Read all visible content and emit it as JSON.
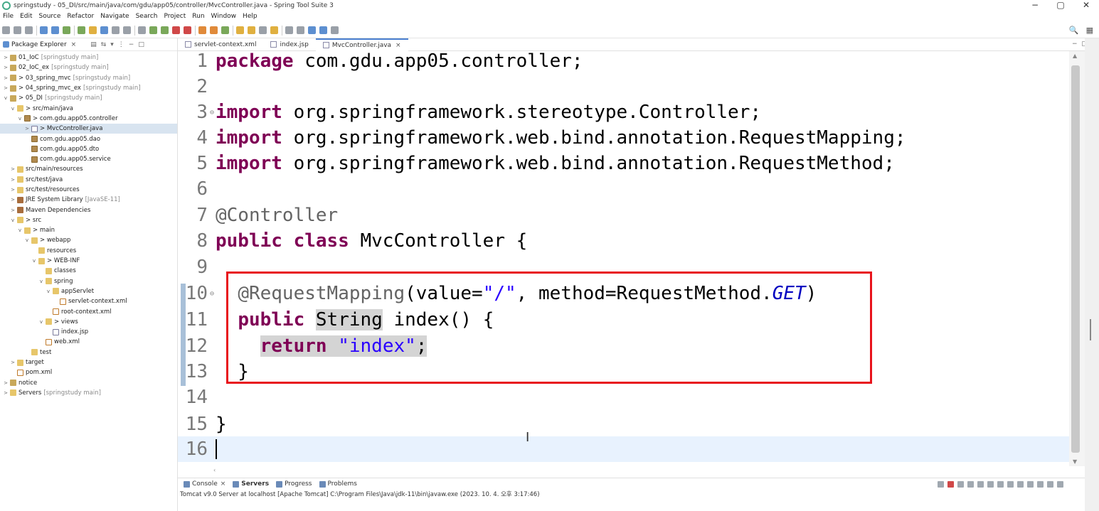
{
  "window": {
    "title": "springstudy - 05_DI/src/main/java/com/gdu/app05/controller/MvcController.java - Spring Tool Suite 3",
    "minimize": "−",
    "maximize": "▢",
    "close": "✕"
  },
  "menu": [
    "File",
    "Edit",
    "Source",
    "Refactor",
    "Navigate",
    "Search",
    "Project",
    "Run",
    "Window",
    "Help"
  ],
  "toolbar_right": {
    "search": "🔍",
    "perspective": "▦"
  },
  "package_explorer": {
    "title": "Package Explorer",
    "close": "×",
    "tree": [
      {
        "arrow": ">",
        "icon": "proj",
        "label": "01_IoC",
        "dec": "[springstudy main]"
      },
      {
        "arrow": ">",
        "icon": "proj",
        "label": "02_IoC_ex",
        "dec": "[springstudy main]"
      },
      {
        "arrow": ">",
        "icon": "proj",
        "label": "> 03_spring_mvc",
        "dec": "[springstudy main]"
      },
      {
        "arrow": ">",
        "icon": "proj",
        "label": "> 04_spring_mvc_ex",
        "dec": "[springstudy main]"
      },
      {
        "arrow": "v",
        "icon": "proj",
        "label": "> 05_DI",
        "dec": "[springstudy main]"
      },
      {
        "arrow": "v",
        "icon": "folder",
        "label": "> src/main/java",
        "dec": ""
      },
      {
        "arrow": "v",
        "icon": "pkg",
        "label": "> com.gdu.app05.controller",
        "dec": ""
      },
      {
        "arrow": ">",
        "icon": "file",
        "label": "> MvcController.java",
        "dec": ""
      },
      {
        "arrow": "",
        "icon": "pkg",
        "label": "com.gdu.app05.dao",
        "dec": ""
      },
      {
        "arrow": "",
        "icon": "pkg",
        "label": "com.gdu.app05.dto",
        "dec": ""
      },
      {
        "arrow": "",
        "icon": "pkg",
        "label": "com.gdu.app05.service",
        "dec": ""
      },
      {
        "arrow": ">",
        "icon": "folder",
        "label": "src/main/resources",
        "dec": ""
      },
      {
        "arrow": ">",
        "icon": "folder",
        "label": "src/test/java",
        "dec": ""
      },
      {
        "arrow": ">",
        "icon": "folder",
        "label": "src/test/resources",
        "dec": ""
      },
      {
        "arrow": ">",
        "icon": "lib",
        "label": "JRE System Library",
        "dec": "[JavaSE-11]"
      },
      {
        "arrow": ">",
        "icon": "lib",
        "label": "Maven Dependencies",
        "dec": ""
      },
      {
        "arrow": "v",
        "icon": "folder",
        "label": "> src",
        "dec": ""
      },
      {
        "arrow": "v",
        "icon": "folder",
        "label": "> main",
        "dec": ""
      },
      {
        "arrow": "v",
        "icon": "folder",
        "label": "> webapp",
        "dec": ""
      },
      {
        "arrow": "",
        "icon": "folder",
        "label": "resources",
        "dec": ""
      },
      {
        "arrow": "v",
        "icon": "folder",
        "label": "> WEB-INF",
        "dec": ""
      },
      {
        "arrow": "",
        "icon": "folder",
        "label": "classes",
        "dec": ""
      },
      {
        "arrow": "v",
        "icon": "folder",
        "label": "spring",
        "dec": ""
      },
      {
        "arrow": "v",
        "icon": "folder",
        "label": "appServlet",
        "dec": ""
      },
      {
        "arrow": "",
        "icon": "xml",
        "label": "servlet-context.xml",
        "dec": ""
      },
      {
        "arrow": "",
        "icon": "xml",
        "label": "root-context.xml",
        "dec": ""
      },
      {
        "arrow": "v",
        "icon": "folder",
        "label": "> views",
        "dec": ""
      },
      {
        "arrow": "",
        "icon": "file",
        "label": "index.jsp",
        "dec": ""
      },
      {
        "arrow": "",
        "icon": "xml",
        "label": "web.xml",
        "dec": ""
      },
      {
        "arrow": "",
        "icon": "folder",
        "label": "test",
        "dec": ""
      },
      {
        "arrow": ">",
        "icon": "folder",
        "label": "target",
        "dec": ""
      },
      {
        "arrow": "",
        "icon": "xml",
        "label": "pom.xml",
        "dec": ""
      },
      {
        "arrow": ">",
        "icon": "proj",
        "label": "notice",
        "dec": ""
      },
      {
        "arrow": ">",
        "icon": "folder",
        "label": "Servers",
        "dec": "[springstudy main]"
      }
    ]
  },
  "tabs": [
    {
      "label": "servlet-context.xml",
      "active": false
    },
    {
      "label": "index.jsp",
      "active": false
    },
    {
      "label": "MvcController.java",
      "active": true,
      "close": "×"
    }
  ],
  "editor": {
    "lines": [
      {
        "n": "1",
        "fold": "",
        "segs": [
          [
            "kw",
            "package"
          ],
          [
            "code",
            " com.gdu.app05.controller;"
          ]
        ]
      },
      {
        "n": "2",
        "fold": "",
        "segs": []
      },
      {
        "n": "3",
        "fold": "⊖",
        "segs": [
          [
            "kw",
            "import"
          ],
          [
            "code",
            " org.springframework.stereotype.Controller;"
          ]
        ]
      },
      {
        "n": "4",
        "fold": "",
        "segs": [
          [
            "kw",
            "import"
          ],
          [
            "code",
            " org.springframework.web.bind.annotation.RequestMapping;"
          ]
        ]
      },
      {
        "n": "5",
        "fold": "",
        "segs": [
          [
            "kw",
            "import"
          ],
          [
            "code",
            " org.springframework.web.bind.annotation.RequestMethod;"
          ]
        ]
      },
      {
        "n": "6",
        "fold": "",
        "segs": []
      },
      {
        "n": "7",
        "fold": "",
        "segs": [
          [
            "ann",
            "@Controller"
          ]
        ]
      },
      {
        "n": "8",
        "fold": "",
        "segs": [
          [
            "kw",
            "public class"
          ],
          [
            "code",
            " MvcController {"
          ]
        ]
      },
      {
        "n": "9",
        "fold": "",
        "segs": []
      },
      {
        "n": "10",
        "fold": "⊖",
        "segs": [
          [
            "code",
            "  "
          ],
          [
            "ann",
            "@RequestMapping"
          ],
          [
            "code",
            "(value="
          ],
          [
            "str",
            "\"/\""
          ],
          [
            "code",
            ", method=RequestMethod."
          ],
          [
            "stat",
            "GET"
          ],
          [
            "code",
            ")"
          ]
        ]
      },
      {
        "n": "11",
        "fold": "",
        "segs": [
          [
            "code",
            "  "
          ],
          [
            "kw",
            "public"
          ],
          [
            "code",
            " "
          ],
          [
            "hl",
            "String"
          ],
          [
            "code",
            " index() {"
          ]
        ]
      },
      {
        "n": "12",
        "fold": "",
        "segs": [
          [
            "code",
            "    "
          ],
          [
            "kwhl",
            "return"
          ],
          [
            "strhl",
            " \"index\""
          ],
          [
            "hl",
            ";"
          ]
        ]
      },
      {
        "n": "13",
        "fold": "",
        "segs": [
          [
            "code",
            "  }"
          ]
        ]
      },
      {
        "n": "14",
        "fold": "",
        "segs": []
      },
      {
        "n": "15",
        "fold": "",
        "segs": [
          [
            "code",
            "}"
          ]
        ]
      },
      {
        "n": "16",
        "fold": "",
        "segs": [],
        "current": true
      }
    ]
  },
  "console": {
    "tabs": [
      {
        "label": "Console",
        "close": "×",
        "active": false
      },
      {
        "label": "Servers",
        "active": true
      },
      {
        "label": "Progress",
        "active": false
      },
      {
        "label": "Problems",
        "active": false
      }
    ],
    "status": "Tomcat v9.0 Server at localhost [Apache Tomcat] C:\\Program Files\\Java\\jdk-11\\bin\\javaw.exe  (2023. 10. 4. 오후 3:17:46)"
  },
  "colors": {
    "keyword": "#7f0055",
    "string": "#2a00ff",
    "annotation": "#646464",
    "highlight_box": "#e8141c"
  }
}
